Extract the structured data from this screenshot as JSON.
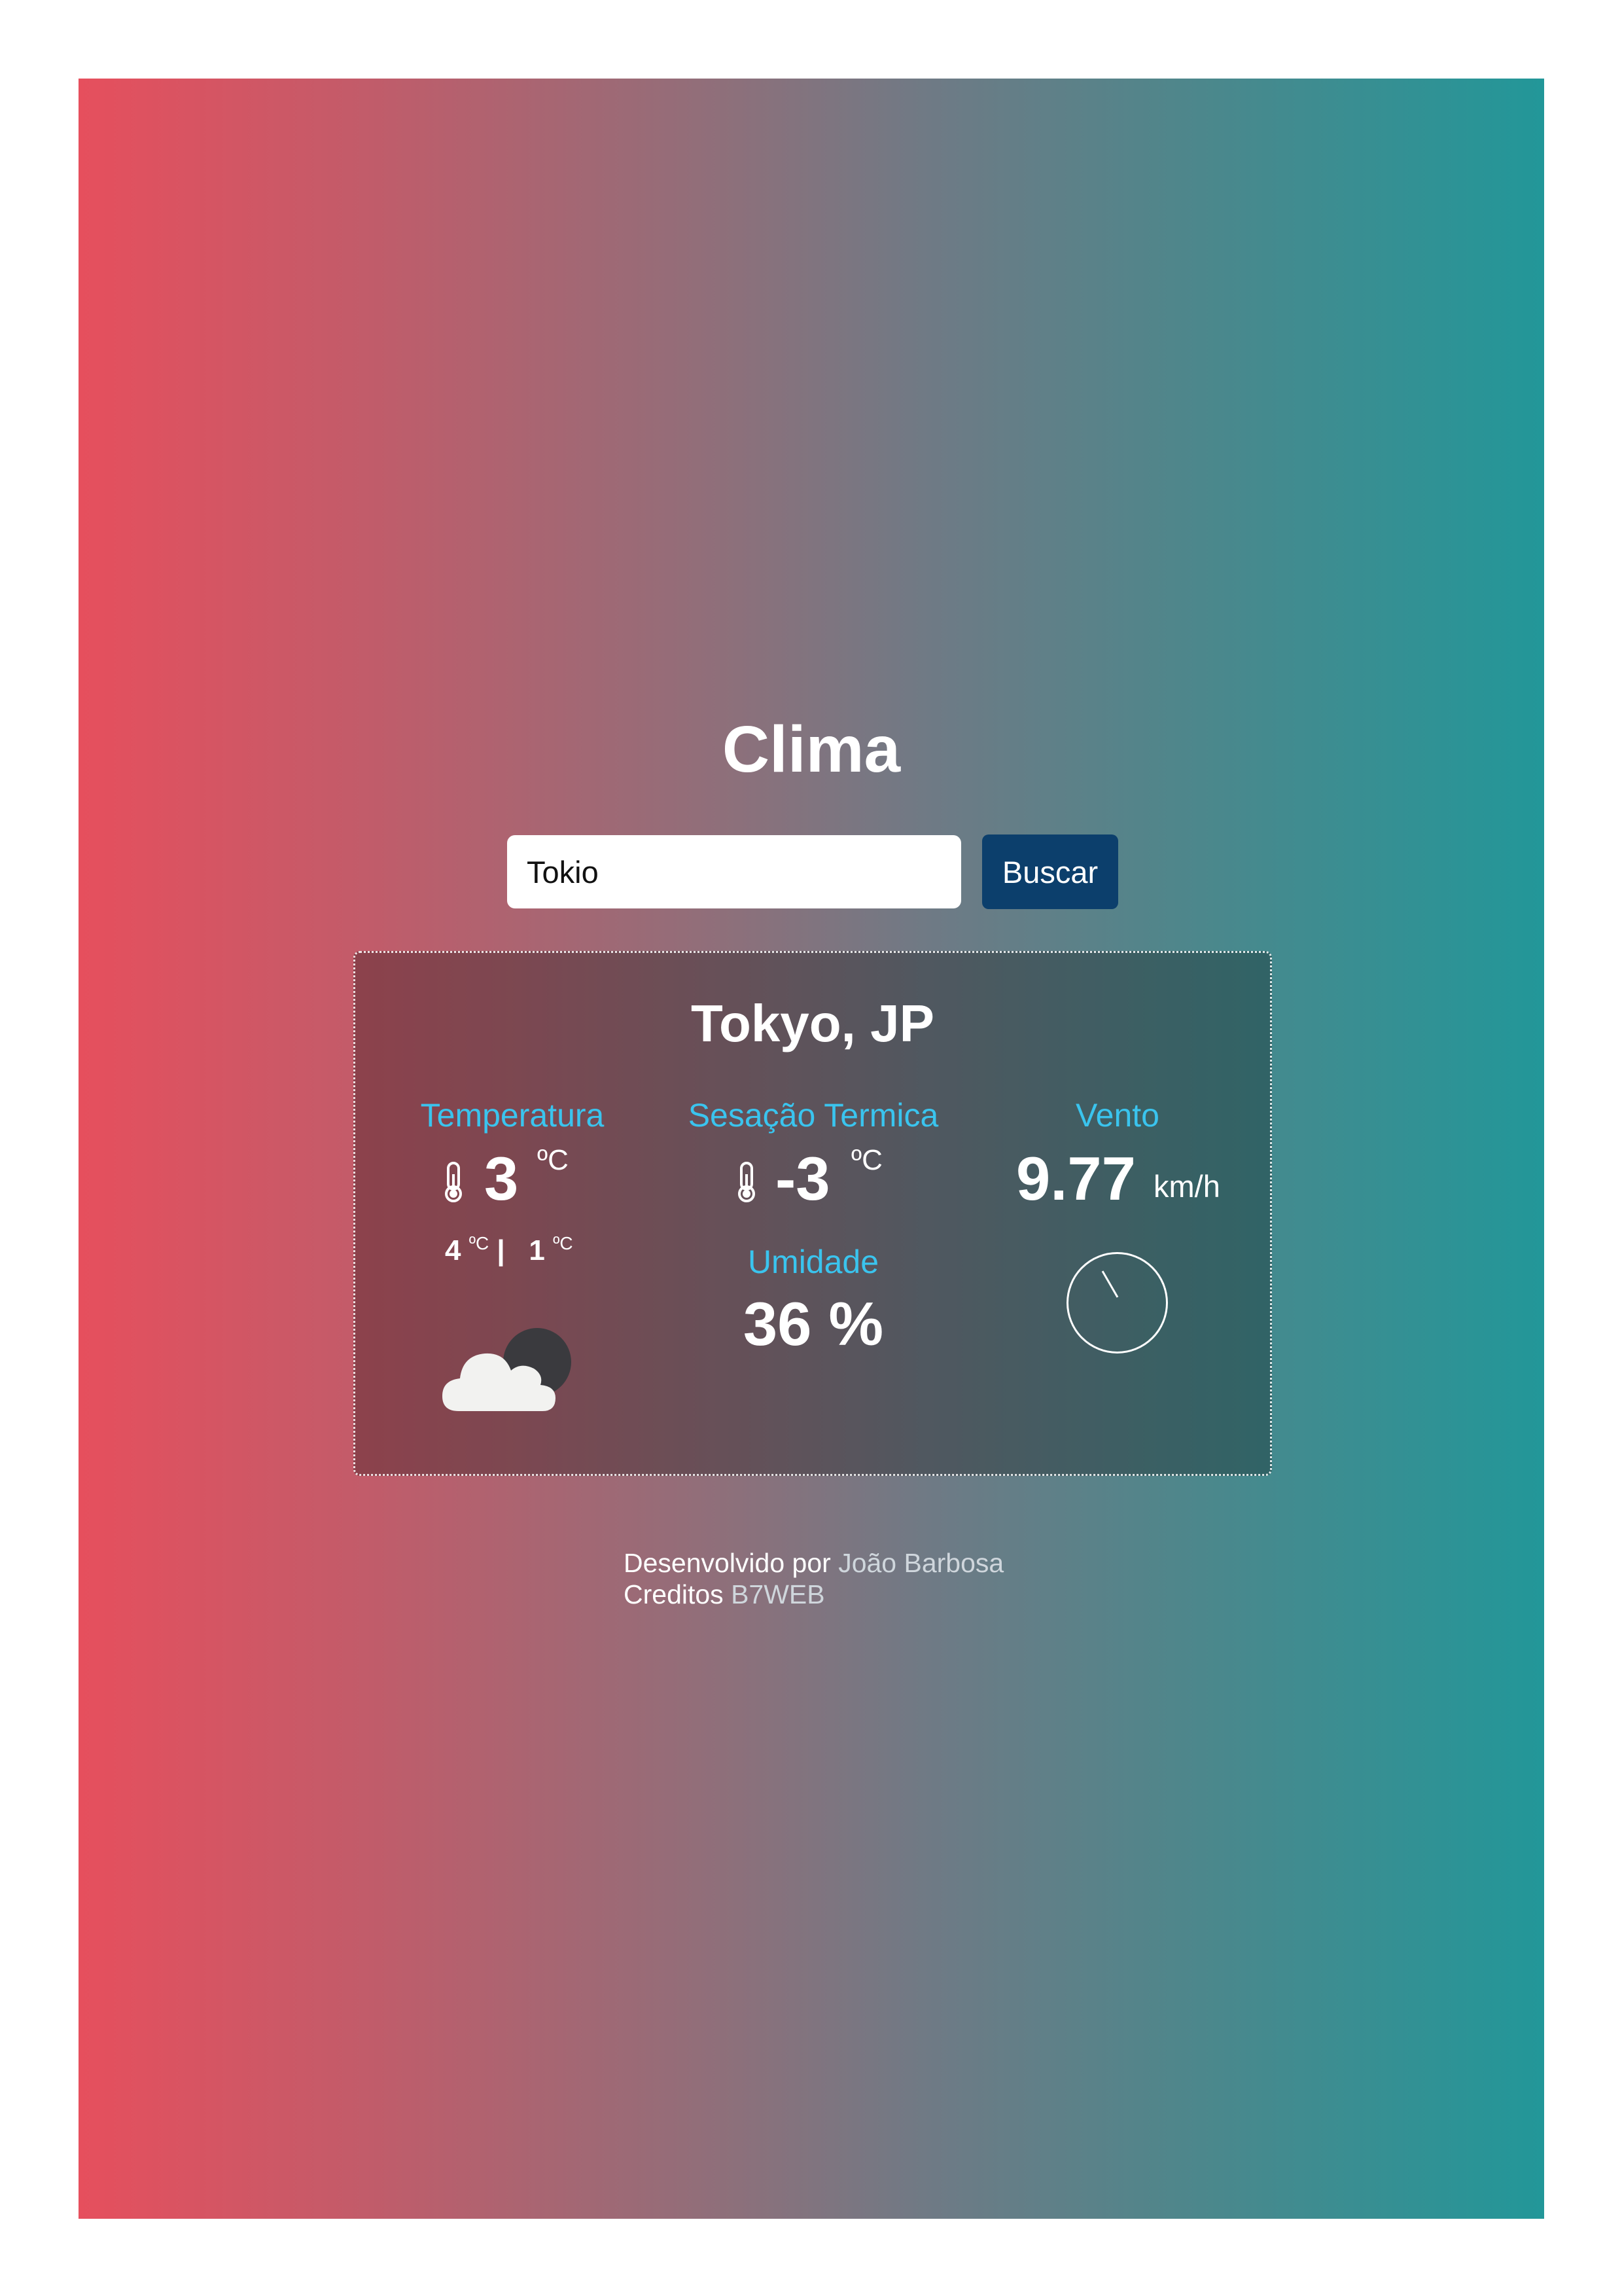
{
  "header": {
    "title": "Clima"
  },
  "search": {
    "value": "Tokio",
    "button_label": "Buscar"
  },
  "weather": {
    "city": "Tokyo, JP",
    "temperature": {
      "label": "Temperatura",
      "value": "3",
      "unit": "ºC",
      "max": "4",
      "min": "1",
      "max_unit": "ºC",
      "min_unit": "ºC",
      "separator": "|"
    },
    "feels_like": {
      "label": "Sesação Termica",
      "value": "-3",
      "unit": "ºC"
    },
    "humidity": {
      "label": "Umidade",
      "value": "36 %"
    },
    "wind": {
      "label": "Vento",
      "value": "9.77",
      "unit": "km/h"
    },
    "icon": "cloud-night-icon"
  },
  "footer": {
    "developed_prefix": "Desenvolvido por",
    "developer_name": "João Barbosa",
    "credits_prefix": "Creditos",
    "credits_name": "B7WEB"
  },
  "colors": {
    "gradient_left": "#e64f5d",
    "gradient_right": "#229799",
    "button": "#0c3f6c",
    "label_accent": "#3ac4ee"
  }
}
